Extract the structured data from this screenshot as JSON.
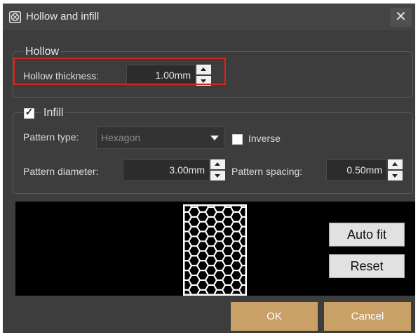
{
  "window": {
    "title": "Hollow and infill",
    "close_glyph": "✕"
  },
  "hollow": {
    "group_title": "Hollow",
    "thickness_label": "Hollow thickness:",
    "thickness_value": "1.00mm"
  },
  "infill": {
    "group_title": "Infill",
    "checked": true,
    "check_glyph": "✓",
    "pattern_type_label": "Pattern type:",
    "pattern_type_value": "Hexagon",
    "inverse_label": "Inverse",
    "inverse_checked": false,
    "pattern_diameter_label": "Pattern diameter:",
    "pattern_diameter_value": "3.00mm",
    "pattern_spacing_label": "Pattern spacing:",
    "pattern_spacing_value": "0.50mm"
  },
  "preview": {
    "auto_fit_label": "Auto fit",
    "reset_label": "Reset"
  },
  "footer": {
    "ok_label": "OK",
    "cancel_label": "Cancel"
  },
  "colors": {
    "dialog_bg": "#3d3d3d",
    "accent_button": "#c9a066",
    "highlight_border": "#e02020",
    "preview_bg": "#000000"
  },
  "icons": {
    "title": "hollow-infill-icon",
    "close": "close-icon"
  }
}
